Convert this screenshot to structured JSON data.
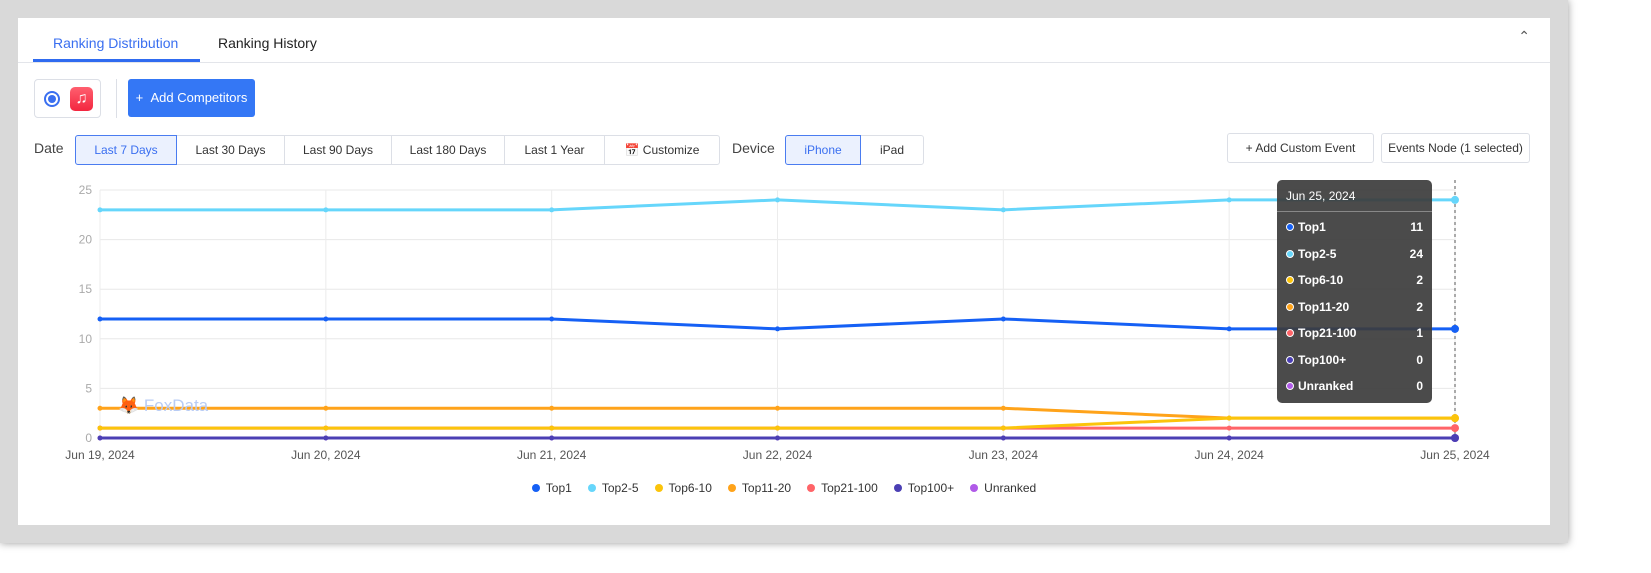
{
  "tabs": [
    {
      "label": "Ranking Distribution",
      "active": true
    },
    {
      "label": "Ranking History",
      "active": false
    }
  ],
  "collapse_icon": "chevron-up-icon",
  "app": {
    "icon": "apple-music-icon",
    "selected": true
  },
  "add_competitors_label": "Add Competitors",
  "date": {
    "label": "Date",
    "options": [
      "Last 7 Days",
      "Last 30 Days",
      "Last 90 Days",
      "Last 180 Days",
      "Last 1 Year",
      "Customize"
    ],
    "selected": "Last 7 Days"
  },
  "device": {
    "label": "Device",
    "options": [
      "iPhone",
      "iPad"
    ],
    "selected": "iPhone"
  },
  "add_custom_event_label": "Add Custom Event",
  "events_node_label": "Events Node (1 selected)",
  "watermark": "FoxData",
  "tooltip": {
    "date": "Jun 25, 2024",
    "rows": [
      [
        "Top1",
        "11"
      ],
      [
        "Top2-5",
        "24"
      ],
      [
        "Top6-10",
        "2"
      ],
      [
        "Top11-20",
        "2"
      ],
      [
        "Top21-100",
        "1"
      ],
      [
        "Top100+",
        "0"
      ],
      [
        "Unranked",
        "0"
      ]
    ]
  },
  "chart_data": {
    "type": "line",
    "categories": [
      "Jun 19, 2024",
      "Jun 20, 2024",
      "Jun 21, 2024",
      "Jun 22, 2024",
      "Jun 23, 2024",
      "Jun 24, 2024",
      "Jun 25, 2024"
    ],
    "ylim": [
      0,
      25
    ],
    "yticks": [
      "0",
      "5",
      "10",
      "15",
      "20",
      "25"
    ],
    "grid": true,
    "legend_position": "bottom",
    "series": [
      {
        "name": "Top1",
        "color": "#1560f5",
        "values": [
          12,
          12,
          12,
          11,
          12,
          11,
          11
        ]
      },
      {
        "name": "Top2-5",
        "color": "#66d6fb",
        "values": [
          23,
          23,
          23,
          24,
          23,
          24,
          24
        ]
      },
      {
        "name": "Top6-10",
        "color": "#fbc40b",
        "values": [
          1,
          1,
          1,
          1,
          1,
          2,
          2
        ]
      },
      {
        "name": "Top11-20",
        "color": "#ffa31a",
        "values": [
          3,
          3,
          3,
          3,
          3,
          2,
          2
        ]
      },
      {
        "name": "Top21-100",
        "color": "#ff6468",
        "values": [
          1,
          1,
          1,
          1,
          1,
          1,
          1
        ]
      },
      {
        "name": "Top100+",
        "color": "#4b3fb4",
        "values": [
          0,
          0,
          0,
          0,
          0,
          0,
          0
        ]
      },
      {
        "name": "Unranked",
        "color": "#b05ae8",
        "values": [
          0,
          0,
          0,
          0,
          0,
          0,
          0
        ]
      }
    ]
  }
}
